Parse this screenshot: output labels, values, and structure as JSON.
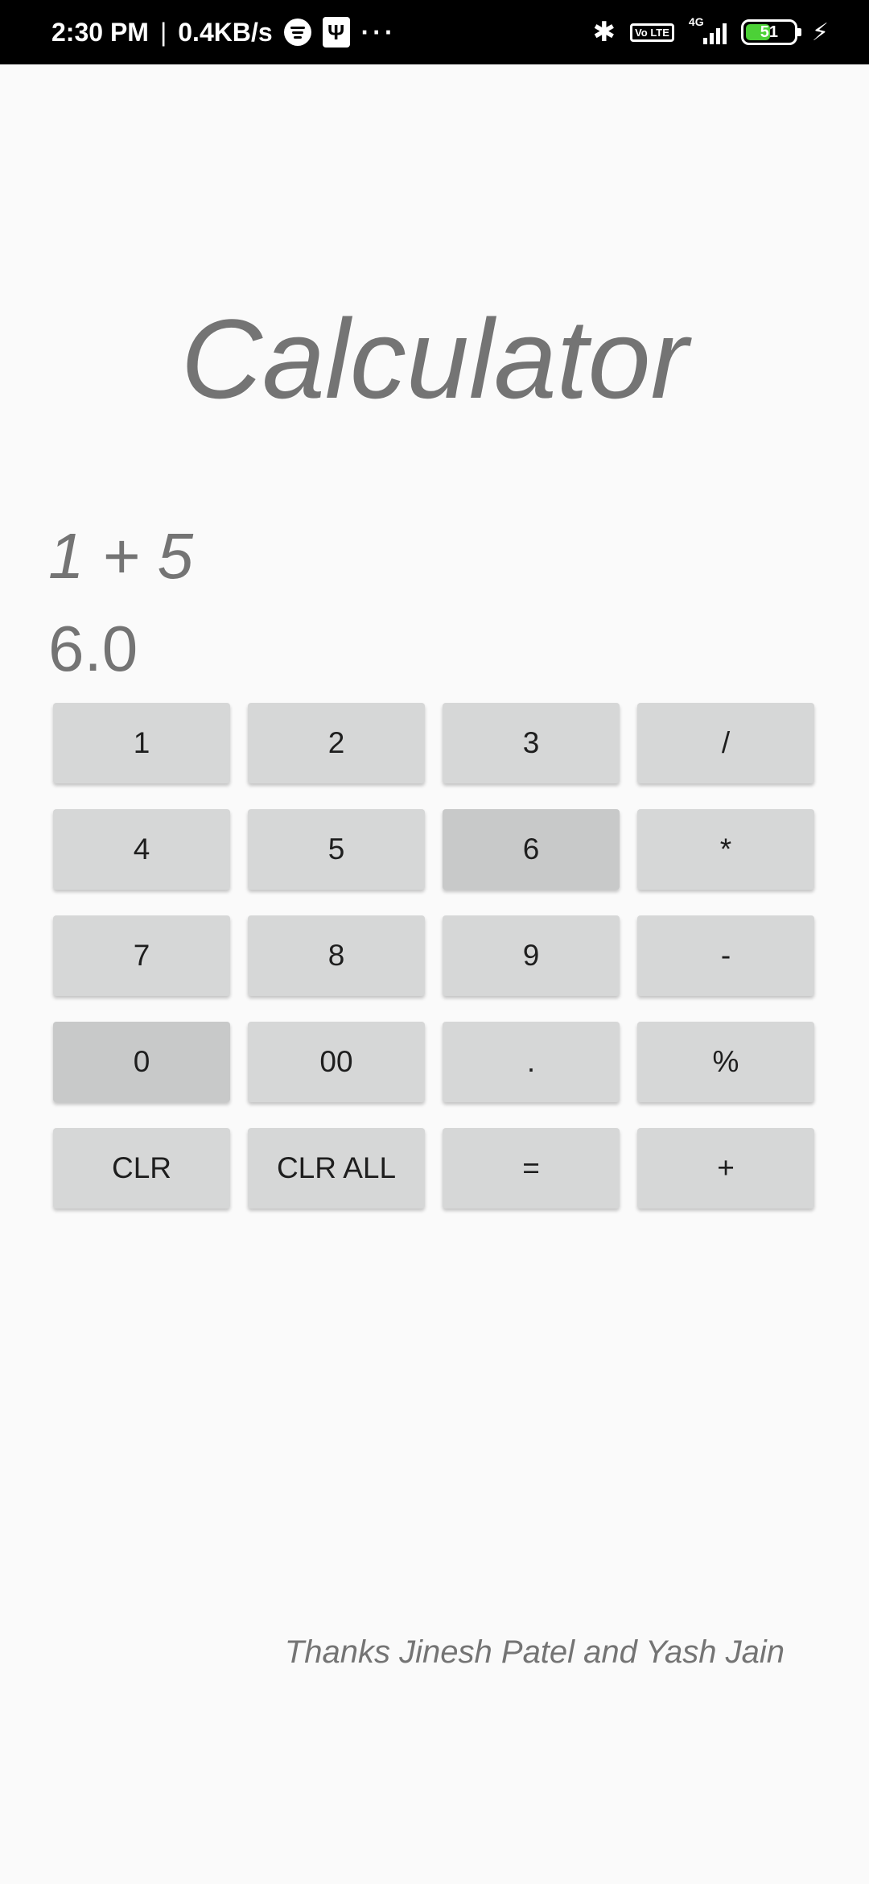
{
  "status_bar": {
    "time": "2:30 PM",
    "separator": "|",
    "speed": "0.4KB/s",
    "more": "···",
    "volte": "Vo LTE",
    "network": "4G",
    "battery": "51"
  },
  "app": {
    "title": "Calculator",
    "expression": "1 + 5",
    "result": "6.0",
    "credits": "Thanks Jinesh Patel and Yash Jain"
  },
  "keypad": {
    "keys": [
      {
        "label": "1",
        "name": "key-1"
      },
      {
        "label": "2",
        "name": "key-2"
      },
      {
        "label": "3",
        "name": "key-3"
      },
      {
        "label": "/",
        "name": "key-divide"
      },
      {
        "label": "4",
        "name": "key-4"
      },
      {
        "label": "5",
        "name": "key-5"
      },
      {
        "label": "6",
        "name": "key-6"
      },
      {
        "label": "*",
        "name": "key-multiply"
      },
      {
        "label": "7",
        "name": "key-7"
      },
      {
        "label": "8",
        "name": "key-8"
      },
      {
        "label": "9",
        "name": "key-9"
      },
      {
        "label": "-",
        "name": "key-subtract"
      },
      {
        "label": "0",
        "name": "key-0"
      },
      {
        "label": "00",
        "name": "key-00"
      },
      {
        "label": ".",
        "name": "key-decimal"
      },
      {
        "label": "%",
        "name": "key-percent"
      },
      {
        "label": "CLR",
        "name": "key-clear"
      },
      {
        "label": "CLR ALL",
        "name": "key-clear-all"
      },
      {
        "label": "=",
        "name": "key-equals"
      },
      {
        "label": "+",
        "name": "key-add"
      }
    ]
  }
}
